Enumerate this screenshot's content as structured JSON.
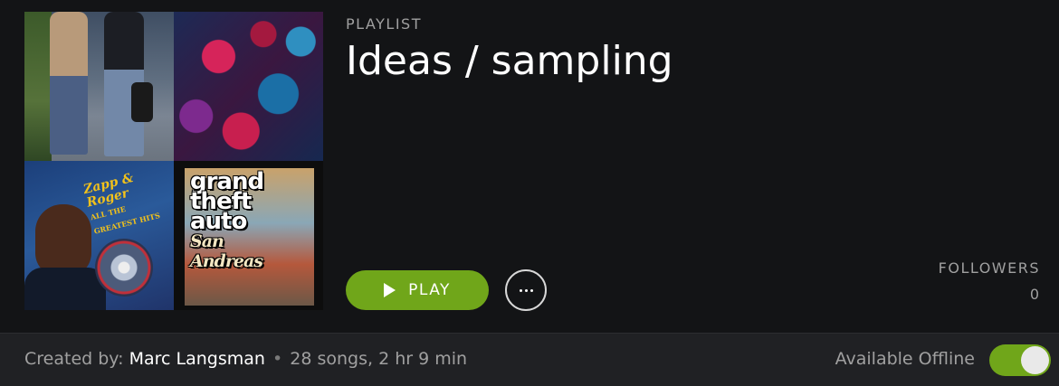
{
  "header": {
    "type_label": "PLAYLIST",
    "title": "Ideas / sampling"
  },
  "cover_art": {
    "tiles": [
      {
        "name": "street-photo"
      },
      {
        "name": "abstract-paint"
      },
      {
        "name": "zapp-roger-album",
        "text": "Zapp & Roger",
        "subtext": "ALL THE GREATEST HITS"
      },
      {
        "name": "gta-san-andreas",
        "text_lines": [
          "grand",
          "theft",
          "auto"
        ],
        "subtitle": "San Andreas"
      }
    ]
  },
  "actions": {
    "play_label": "PLAY",
    "more_icon": "ellipsis-icon"
  },
  "followers": {
    "label": "FOLLOWERS",
    "count": "0"
  },
  "footer": {
    "created_by_label": "Created by:",
    "owner": "Marc Langsman",
    "separator": "•",
    "summary": "28 songs, 2 hr 9 min",
    "offline_label": "Available Offline",
    "offline_enabled": true
  },
  "colors": {
    "accent": "#70a61a",
    "background": "#131416",
    "footer_background": "#202124",
    "muted_text": "#a0a0a0"
  }
}
